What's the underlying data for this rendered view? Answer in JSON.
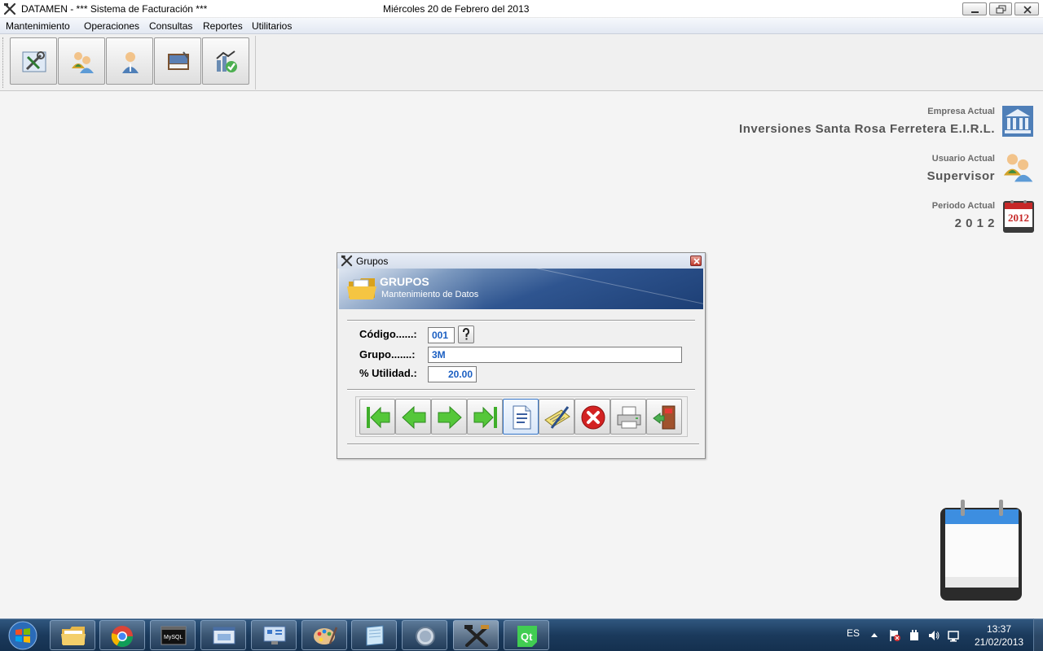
{
  "window": {
    "title": "DATAMEN - *** Sistema de Facturación ***",
    "date_text": "Miércoles 20 de Febrero del 2013"
  },
  "menu": [
    "Mantenimiento",
    "Operaciones",
    "Consultas",
    "Reportes",
    "Utilitarios"
  ],
  "toolbar_icons": [
    "tools-icon",
    "users-icon",
    "person-icon",
    "documents-icon",
    "chart-check-icon"
  ],
  "info": {
    "empresa_label": "Empresa Actual",
    "empresa_value": "Inversiones Santa Rosa Ferretera E.I.R.L.",
    "usuario_label": "Usuario Actual",
    "usuario_value": "Supervisor",
    "periodo_label": "Periodo Actual",
    "periodo_value": "2 0 1 2",
    "calendar_year": "2012"
  },
  "dialog": {
    "title": "Grupos",
    "banner_title": "GRUPOS",
    "banner_subtitle": "Mantenimiento de Datos",
    "fields": {
      "codigo_label": "Código......:",
      "codigo_value": "001",
      "grupo_label": "Grupo.......:",
      "grupo_value": "3M",
      "utilidad_label": "% Utilidad.:",
      "utilidad_value": "20.00"
    },
    "nav_buttons": [
      "first-record-icon",
      "previous-record-icon",
      "next-record-icon",
      "last-record-icon",
      "new-document-icon",
      "edit-icon",
      "delete-icon",
      "print-icon",
      "exit-icon"
    ]
  },
  "taskbar": {
    "language": "ES",
    "time": "13:37",
    "date": "21/02/2013"
  },
  "colors": {
    "banner": "#2f5590",
    "field_text": "#1b5fc2",
    "taskbar": "#1b3a5c"
  }
}
